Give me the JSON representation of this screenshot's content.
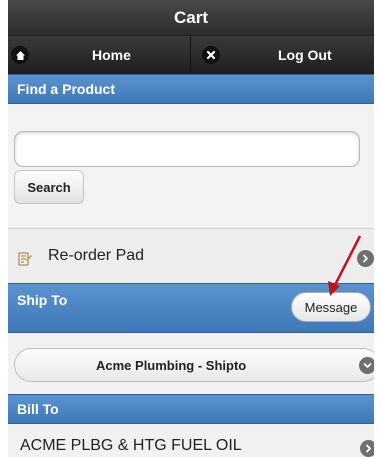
{
  "header": {
    "title": "Cart"
  },
  "nav": {
    "home": {
      "label": "Home",
      "icon": "home-icon"
    },
    "logout": {
      "label": "Log Out",
      "icon": "close-icon"
    }
  },
  "find_product": {
    "title": "Find a Product",
    "search_value": "",
    "search_placeholder": "",
    "search_button": "Search"
  },
  "reorder": {
    "label": "Re-order Pad",
    "icon": "document-icon"
  },
  "ship_to": {
    "title": "Ship To",
    "message_button": "Message",
    "selected": "Acme Plumbing - Shipto"
  },
  "bill_to": {
    "title": "Bill To",
    "value": "ACME PLBG & HTG FUEL OIL"
  },
  "colors": {
    "header_blue": "#4a84c4",
    "toolbar_dark": "#2c2c2c",
    "annotation_red": "#c0141c"
  }
}
